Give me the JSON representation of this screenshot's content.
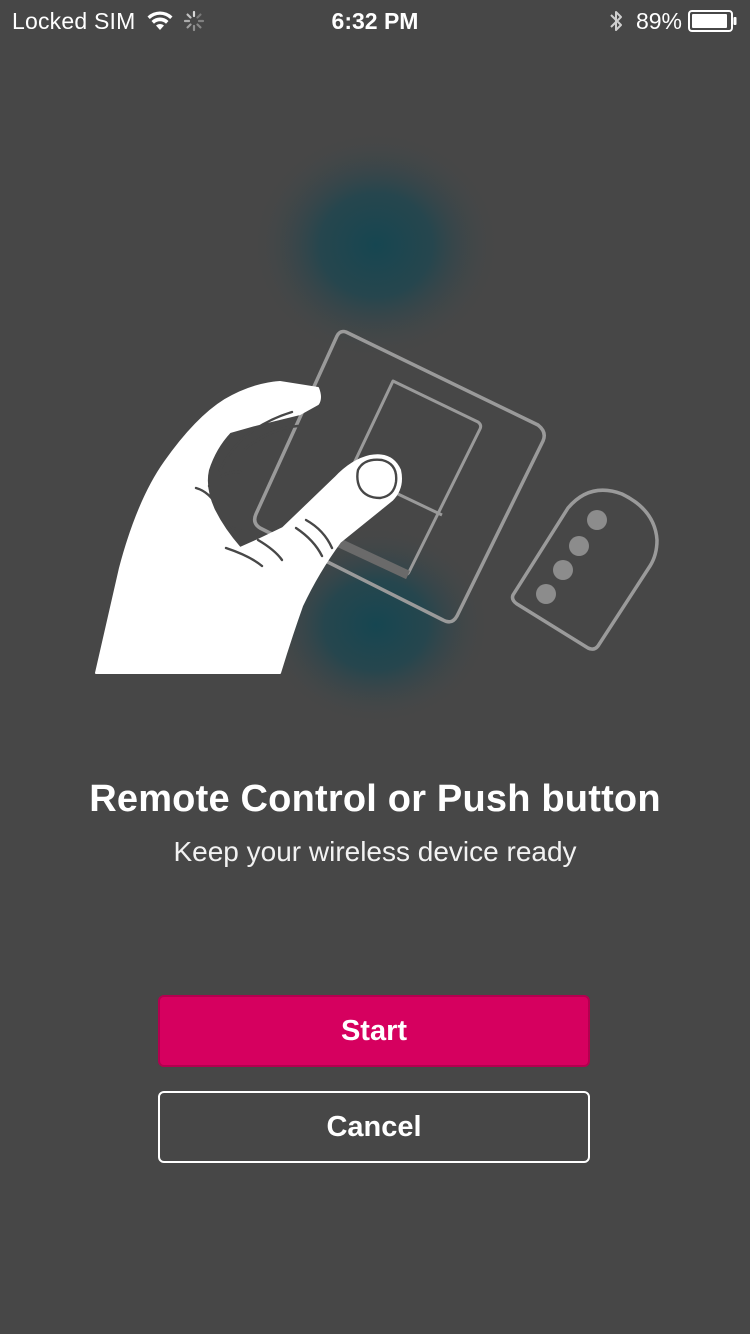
{
  "status_bar": {
    "carrier": "Locked SIM",
    "time": "6:32 PM",
    "battery_percent": "89%",
    "icons": [
      "wifi-icon",
      "activity-spinner-icon",
      "bluetooth-icon",
      "battery-icon"
    ]
  },
  "illustration": {
    "icons": [
      "hand-icon",
      "wall-switch-icon",
      "remote-control-icon"
    ],
    "glow_color": "#1b4550"
  },
  "main": {
    "title": "Remote Control or Push button",
    "subtitle": "Keep your wireless device ready"
  },
  "actions": {
    "start_label": "Start",
    "cancel_label": "Cancel",
    "accent_color": "#d6005f"
  }
}
